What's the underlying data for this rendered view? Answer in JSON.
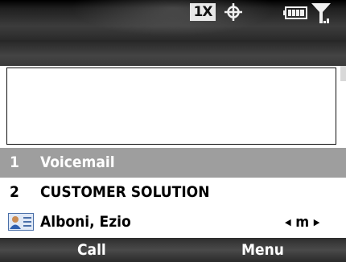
{
  "status_bar": {
    "network_label": "1X",
    "icons": [
      "network-1x-icon",
      "gps-crosshair-icon",
      "battery-icon",
      "signal-strength-icon"
    ]
  },
  "input": {
    "value": ""
  },
  "list": {
    "items": [
      {
        "index": "1",
        "label": "Voicemail",
        "selected": true
      },
      {
        "index": "2",
        "label": "CUSTOMER SOLUTION",
        "selected": false
      },
      {
        "icon": "contact-card-icon",
        "label": "Alboni, Ezio",
        "indicator": "m",
        "selected": false
      }
    ]
  },
  "softkeys": {
    "left": "Call",
    "right": "Menu"
  },
  "colors": {
    "selection": "#9e9e9e",
    "bar_dark": "#2a2a2a",
    "text_light": "#ffffff"
  }
}
